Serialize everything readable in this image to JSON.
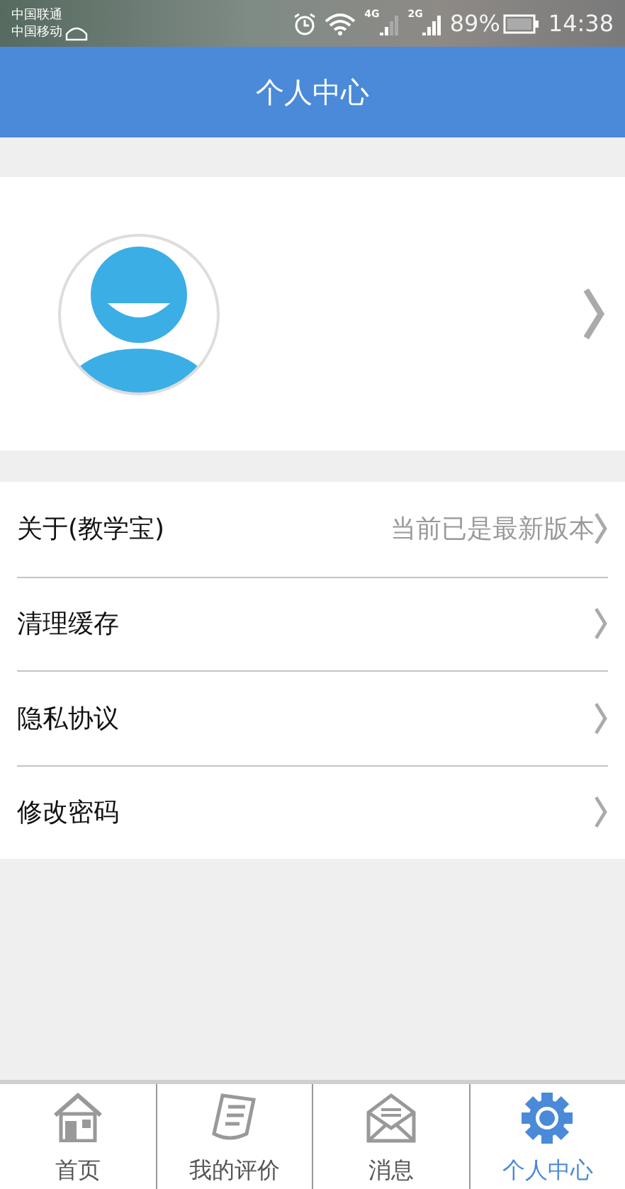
{
  "status_bar": {
    "carriers": [
      "中国联通",
      "中国移动"
    ],
    "network_labels": [
      "4G",
      "2G"
    ],
    "battery": "89%",
    "time": "14:38"
  },
  "header": {
    "title": "个人中心"
  },
  "menu": [
    {
      "label": "关于(教学宝)",
      "value": "当前已是最新版本"
    },
    {
      "label": "清理缓存"
    },
    {
      "label": "隐私协议"
    },
    {
      "label": "修改密码"
    }
  ],
  "tabs": [
    {
      "label": "首页",
      "kind": "home",
      "selected": false
    },
    {
      "label": "我的评价",
      "kind": "review",
      "selected": false
    },
    {
      "label": "消息",
      "kind": "message",
      "selected": false
    },
    {
      "label": "个人中心",
      "kind": "profile",
      "selected": true
    }
  ]
}
